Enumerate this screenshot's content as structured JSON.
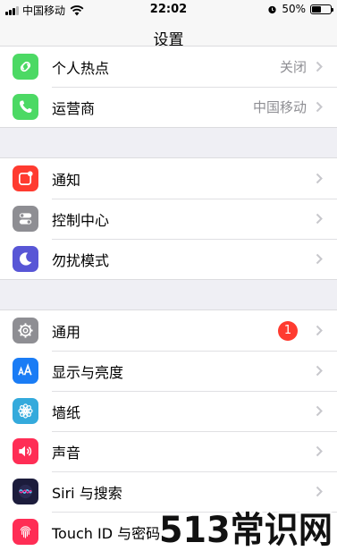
{
  "status_bar": {
    "carrier": "中国移动",
    "time": "22:02",
    "battery_percent": "50%",
    "battery_level": 0.5
  },
  "nav": {
    "title": "设置"
  },
  "groups": [
    {
      "rows": [
        {
          "label": "个人热点",
          "value": "关闭",
          "icon": "hotspot-icon",
          "color": "#4cd964"
        },
        {
          "label": "运营商",
          "value": "中国移动",
          "icon": "phone-icon",
          "color": "#4cd964"
        }
      ]
    },
    {
      "rows": [
        {
          "label": "通知",
          "icon": "notifications-icon",
          "color": "#ff3b30"
        },
        {
          "label": "控制中心",
          "icon": "control-center-icon",
          "color": "#8e8e93"
        },
        {
          "label": "勿扰模式",
          "icon": "moon-icon",
          "color": "#5856d6"
        }
      ]
    },
    {
      "rows": [
        {
          "label": "通用",
          "badge": "1",
          "icon": "gear-icon",
          "color": "#8e8e93"
        },
        {
          "label": "显示与亮度",
          "icon": "display-brightness-icon",
          "color": "#1a7cf5"
        },
        {
          "label": "墙纸",
          "icon": "wallpaper-flower-icon",
          "color": "#34aadc"
        },
        {
          "label": "声音",
          "icon": "speaker-icon",
          "color": "#ff2d55"
        },
        {
          "label": "Siri 与搜索",
          "icon": "siri-icon",
          "color": "#1c1c3c"
        },
        {
          "label": "Touch ID 与密码",
          "icon": "fingerprint-icon",
          "color": "#ff2d55"
        }
      ]
    }
  ],
  "watermark": {
    "text": "513常识网"
  }
}
